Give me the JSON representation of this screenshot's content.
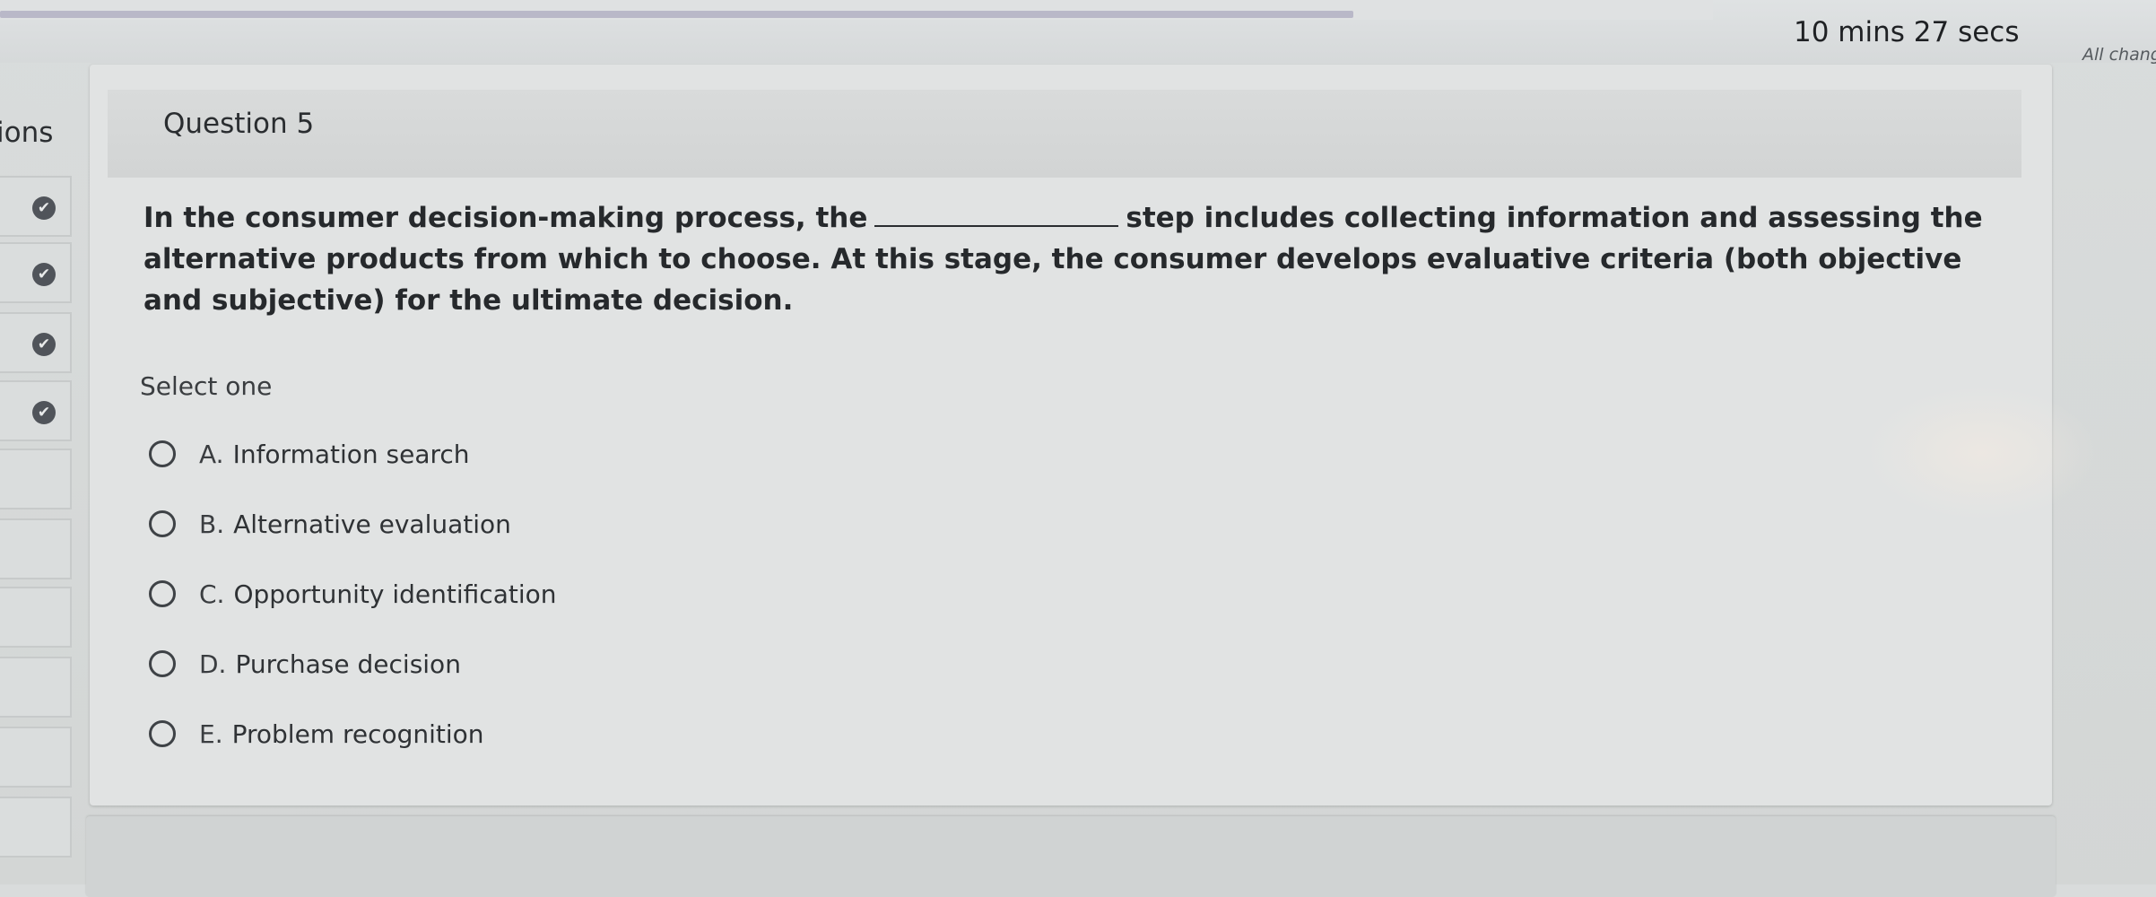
{
  "header": {
    "timer": "10 mins 27 secs",
    "autosave_note": "All chang",
    "progress_fraction": 0.79
  },
  "sidebar": {
    "title": "ions",
    "items": [
      {
        "status": "answered",
        "icon": "check-circle-icon"
      },
      {
        "status": "answered",
        "icon": "check-circle-icon"
      },
      {
        "status": "answered",
        "icon": "check-circle-icon"
      },
      {
        "status": "answered",
        "icon": "check-circle-icon"
      },
      {
        "status": "unanswered"
      },
      {
        "status": "unanswered"
      },
      {
        "status": "unanswered"
      },
      {
        "status": "unanswered"
      },
      {
        "status": "unanswered"
      },
      {
        "status": "unanswered"
      }
    ]
  },
  "question": {
    "title": "Question 5",
    "text_before_blank": "In the consumer decision-making process, the",
    "text_after_blank": "step includes collecting information and assessing the alternative products from which to choose. At this stage, the consumer develops evaluative criteria (both objective and subjective) for the ultimate decision.",
    "select_prompt": "Select one",
    "options": [
      {
        "letter": "A.",
        "label": "Information search"
      },
      {
        "letter": "B.",
        "label": "Alternative evaluation"
      },
      {
        "letter": "C.",
        "label": "Opportunity identification"
      },
      {
        "letter": "D.",
        "label": "Purchase decision"
      },
      {
        "letter": "E.",
        "label": "Problem recognition"
      }
    ]
  }
}
